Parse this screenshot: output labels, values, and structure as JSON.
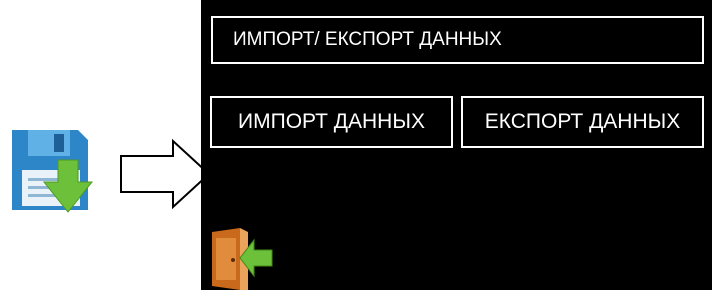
{
  "panel": {
    "title": "ИМПОРТ/ ЕКСПОРТ  ДАННЫХ",
    "import_label": "ИМПОРТ ДАННЫХ",
    "export_label": "ЕКСПОРТ ДАННЫХ"
  },
  "icons": {
    "save": "save-download-icon",
    "arrow": "right-arrow-icon",
    "exit": "exit-door-icon"
  },
  "colors": {
    "panel_bg": "#000000",
    "border": "#ffffff",
    "text": "#ffffff",
    "floppy_blue": "#2d86c8",
    "download_green": "#6cc03a",
    "door_orange": "#c8691b"
  }
}
